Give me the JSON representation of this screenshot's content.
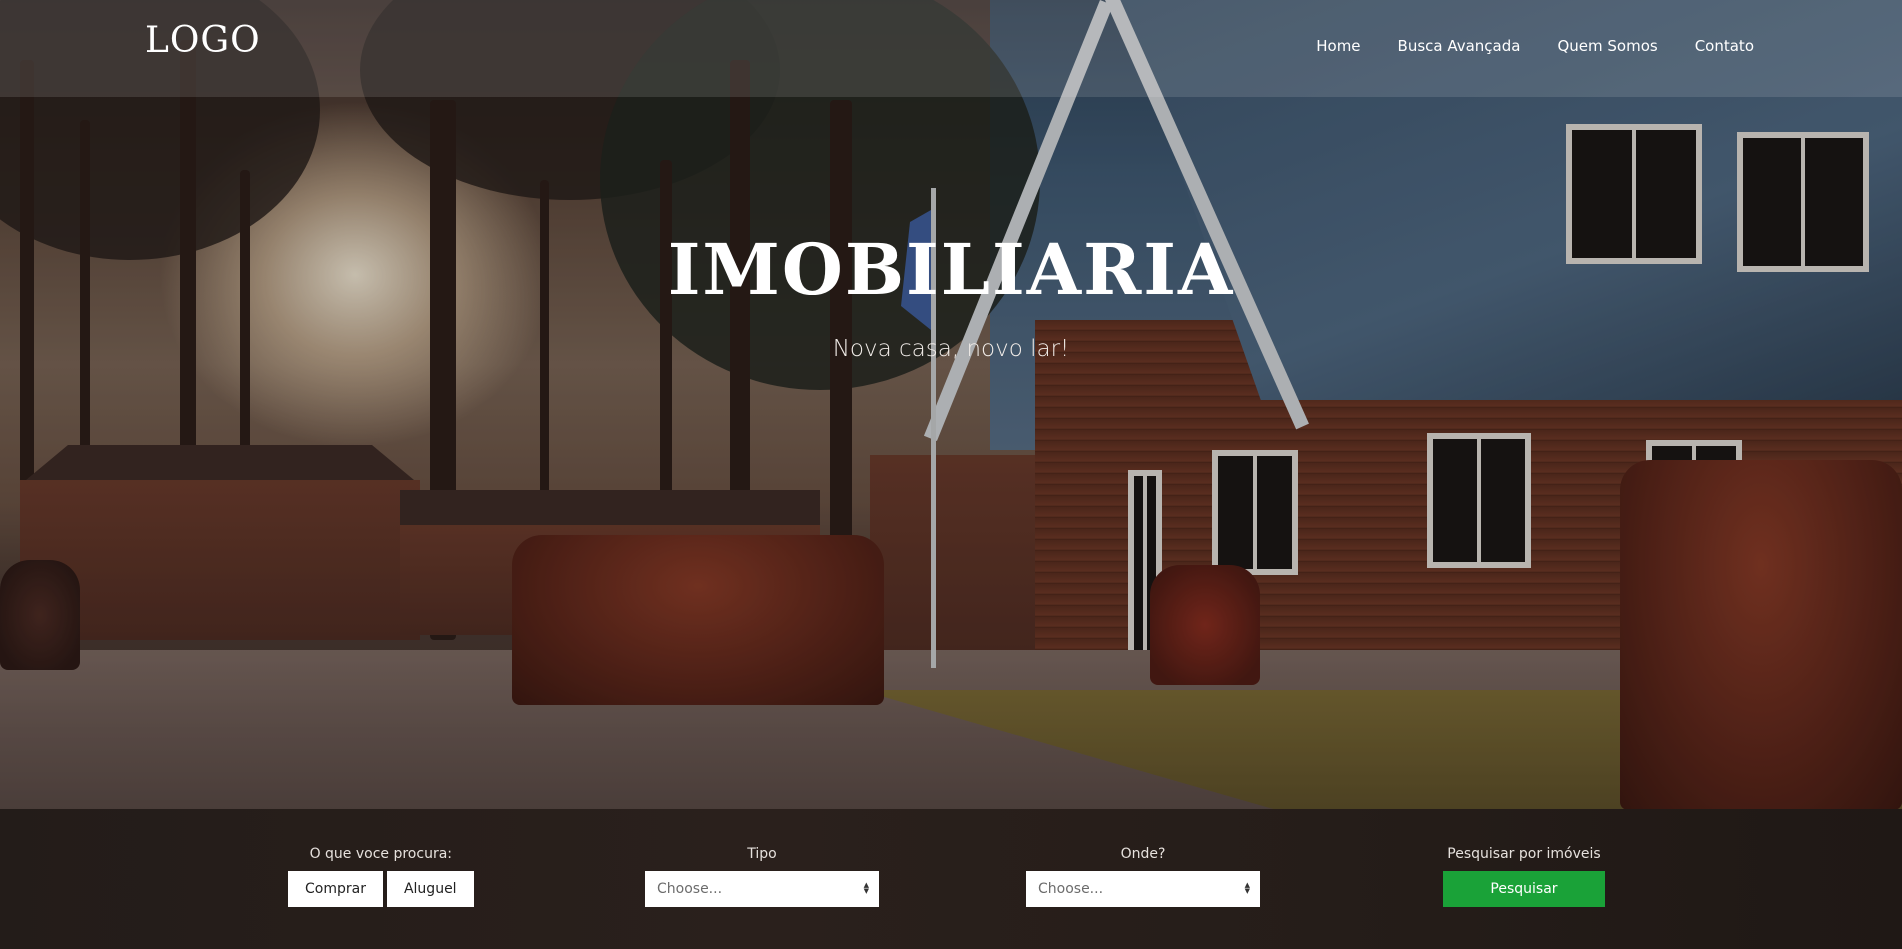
{
  "navbar": {
    "logo": "LOGO",
    "links": [
      "Home",
      "Busca Avançada",
      "Quem Somos",
      "Contato"
    ]
  },
  "hero": {
    "title": "IMOBILIARIA",
    "subtitle": "Nova casa, novo lar!"
  },
  "search": {
    "what": {
      "label": "O que voce procura:",
      "buttons": [
        "Comprar",
        "Aluguel"
      ]
    },
    "type": {
      "label": "Tipo",
      "selected": "Choose..."
    },
    "where": {
      "label": "Onde?",
      "selected": "Choose..."
    },
    "submit": {
      "label": "Pesquisar por imóveis",
      "button": "Pesquisar"
    }
  },
  "colors": {
    "accent_green": "#1aa238",
    "overlay_dark": "#231c19"
  },
  "icons": {
    "select_arrow": "select-arrows-icon"
  }
}
